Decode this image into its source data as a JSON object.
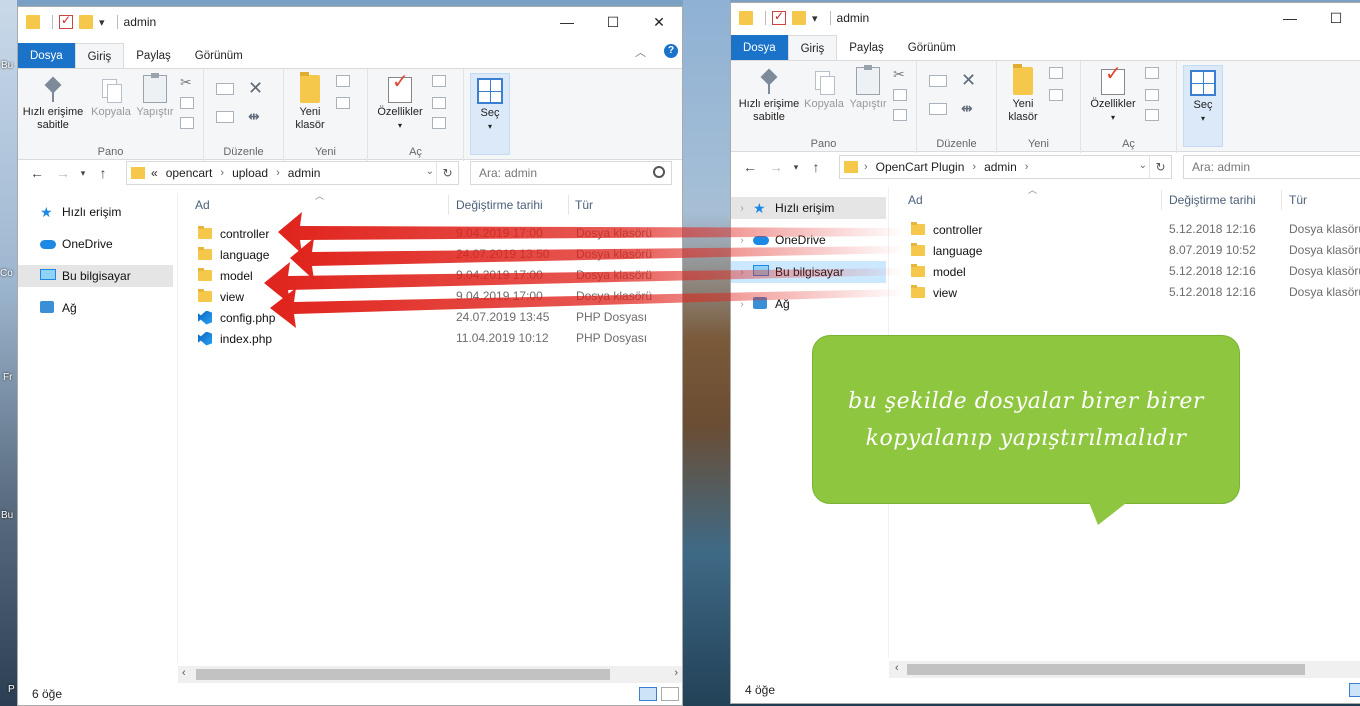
{
  "desktop": {
    "edge_labels": [
      "Bu",
      "Co",
      "Fr",
      "Bu",
      "P"
    ]
  },
  "left_window": {
    "title": "admin",
    "qat_dropdown": "▾",
    "controls": {
      "minimize": "—",
      "maximize": "☐",
      "close": "✕"
    },
    "tabs": {
      "file": "Dosya",
      "home": "Giriş",
      "share": "Paylaş",
      "view": "Görünüm"
    },
    "help": "?",
    "ribbon": {
      "pin": "Hızlı erişime sabitle",
      "copy": "Kopyala",
      "paste": "Yapıştır",
      "new_folder": "Yeni klasör",
      "properties": "Özellikler",
      "select": "Seç",
      "groups": {
        "clipboard": "Pano",
        "organize": "Düzenle",
        "new": "Yeni",
        "open": "Aç"
      }
    },
    "address": {
      "overflow": "«",
      "crumbs": [
        "opencart",
        "upload",
        "admin"
      ],
      "search_placeholder": "Ara: admin"
    },
    "nav": [
      "Hızlı erişim",
      "OneDrive",
      "Bu bilgisayar",
      "Ağ"
    ],
    "columns": {
      "name": "Ad",
      "date": "Değiştirme tarihi",
      "type": "Tür"
    },
    "files": [
      {
        "name": "controller",
        "date": "9.04.2019 17:00",
        "type": "Dosya klasörü",
        "kind": "folder"
      },
      {
        "name": "language",
        "date": "24.07.2019 13:50",
        "type": "Dosya klasörü",
        "kind": "folder"
      },
      {
        "name": "model",
        "date": "9.04.2019 17:00",
        "type": "Dosya klasörü",
        "kind": "folder"
      },
      {
        "name": "view",
        "date": "9.04.2019 17:00",
        "type": "Dosya klasörü",
        "kind": "folder"
      },
      {
        "name": "config.php",
        "date": "24.07.2019 13:45",
        "type": "PHP Dosyası",
        "kind": "php"
      },
      {
        "name": "index.php",
        "date": "11.04.2019 10:12",
        "type": "PHP Dosyası",
        "kind": "php"
      }
    ],
    "status": "6 öğe"
  },
  "right_window": {
    "title": "admin",
    "qat_dropdown": "▾",
    "controls": {
      "minimize": "—",
      "maximize": "☐"
    },
    "tabs": {
      "file": "Dosya",
      "home": "Giriş",
      "share": "Paylaş",
      "view": "Görünüm"
    },
    "ribbon": {
      "pin": "Hızlı erişime sabitle",
      "copy": "Kopyala",
      "paste": "Yapıştır",
      "new_folder": "Yeni klasör",
      "properties": "Özellikler",
      "select": "Seç",
      "groups": {
        "clipboard": "Pano",
        "organize": "Düzenle",
        "new": "Yeni",
        "open": "Aç"
      }
    },
    "address": {
      "crumbs": [
        "OpenCart Plugin",
        "admin"
      ],
      "search_placeholder": "Ara: admin"
    },
    "nav": [
      "Hızlı erişim",
      "OneDrive",
      "Bu bilgisayar",
      "Ağ"
    ],
    "columns": {
      "name": "Ad",
      "date": "Değiştirme tarihi",
      "type": "Tür"
    },
    "files": [
      {
        "name": "controller",
        "date": "5.12.2018 12:16",
        "type": "Dosya klasörü"
      },
      {
        "name": "language",
        "date": "8.07.2019 10:52",
        "type": "Dosya klasörü"
      },
      {
        "name": "model",
        "date": "5.12.2018 12:16",
        "type": "Dosya klasörü"
      },
      {
        "name": "view",
        "date": "5.12.2018 12:16",
        "type": "Dosya klasörü"
      }
    ],
    "status": "4 öğe"
  },
  "callout": {
    "line1": "bu şekilde dosyalar birer birer",
    "line2": "kopyalanıp yapıştırılmalıdır"
  },
  "colors": {
    "accent": "#1a73c8",
    "callout": "#8ec63f",
    "arrow": "#e0231c",
    "folder": "#f5c84c"
  }
}
